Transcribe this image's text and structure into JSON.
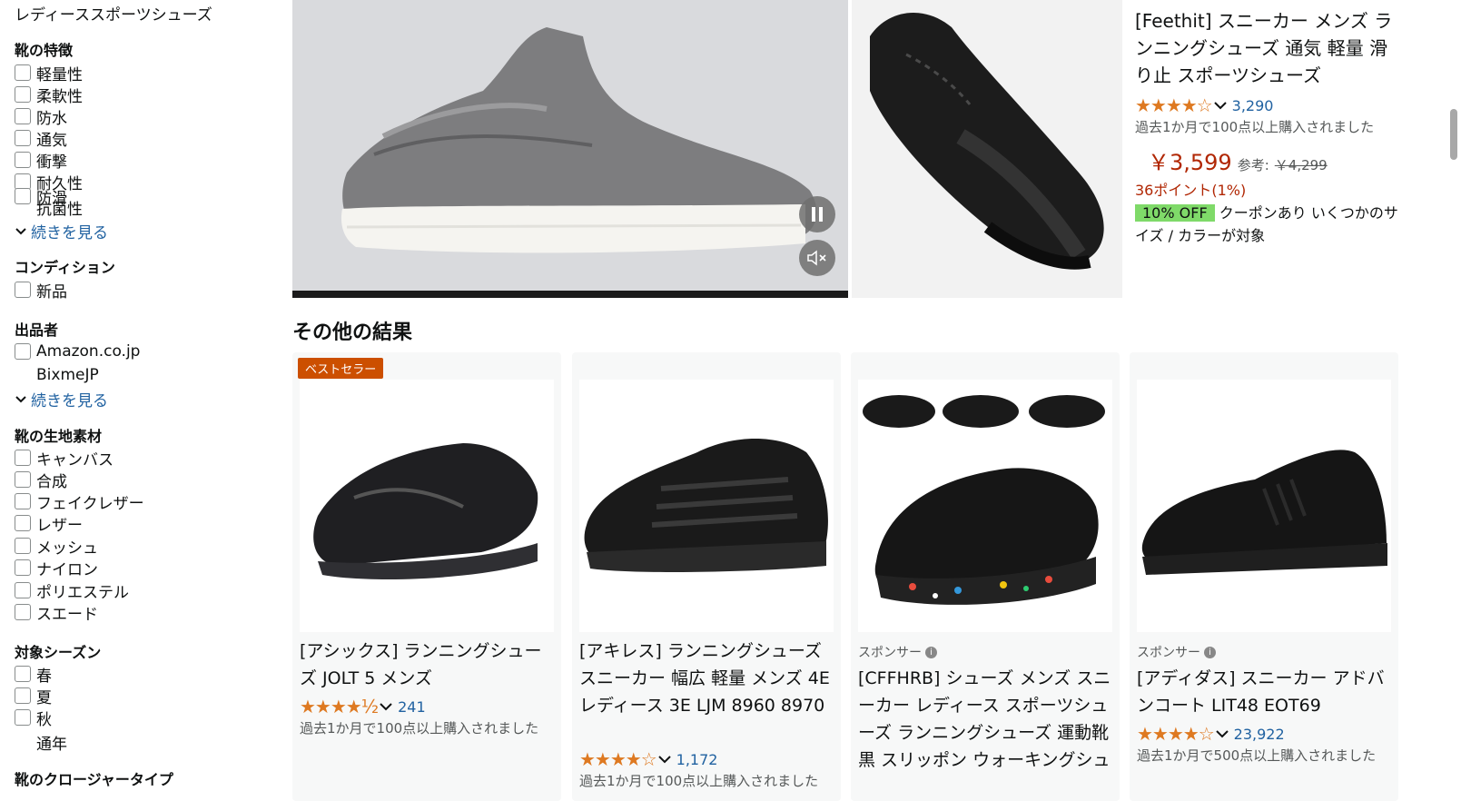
{
  "sidebar": {
    "top_link": "レディーススポーツシューズ",
    "features": {
      "heading": "靴の特徴",
      "options": [
        "軽量性",
        "柔軟性",
        "防水",
        "通気",
        "衝撃",
        "耐久性",
        "防滑",
        "抗菌性"
      ],
      "more": "続きを見る"
    },
    "condition": {
      "heading": "コンディション",
      "options": [
        "新品"
      ]
    },
    "seller": {
      "heading": "出品者",
      "options": [
        "Amazon.co.jp",
        "BixmeJP"
      ],
      "more": "続きを見る"
    },
    "material": {
      "heading": "靴の生地素材",
      "options": [
        "キャンバス",
        "合成",
        "フェイクレザー",
        "レザー",
        "メッシュ",
        "ナイロン",
        "ポリエステル",
        "スエード"
      ]
    },
    "season": {
      "heading": "対象シーズン",
      "options": [
        "春",
        "夏",
        "秋",
        "通年"
      ]
    },
    "closure": {
      "heading": "靴のクロージャータイプ"
    }
  },
  "hero": {
    "title": "[Feethit] スニーカー メンズ ランニングシューズ 通気 軽量 滑り止 スポーツシューズ",
    "rating_stars": "★★★★☆",
    "rating_count": "3,290",
    "bought": "過去1か月で100点以上購入されました",
    "price": "￥3,599",
    "ref_label": "参考:",
    "ref_price": "￥4,299",
    "points": "36ポイント(1%)",
    "coupon_badge": "10% OFF",
    "coupon_text": "クーポンあり いくつかのサイズ / カラーが対象"
  },
  "more_results": {
    "title": "その他の結果",
    "sponsor_label": "スポンサー",
    "cards": [
      {
        "badge": "ベストセラー",
        "title": "[アシックス] ランニングシューズ JOLT 5 メンズ",
        "stars": "★★★★½",
        "count": "241",
        "bought": "過去1か月で100点以上購入されました"
      },
      {
        "title": "[アキレス] ランニングシューズ スニーカー 幅広 軽量 メンズ 4E レディース 3E LJM 8960 8970",
        "stars": "★★★★☆",
        "count": "1,172",
        "bought": "過去1か月で100点以上購入されました"
      },
      {
        "title": "[CFFHRB] シューズ メンズ スニーカー レディース スポーツシューズ ランニングシューズ 運動靴 黒 スリッポン ウォーキングシューズ"
      },
      {
        "title": "[アディダス] スニーカー アドバンコート LIT48 EOT69",
        "stars": "★★★★☆",
        "count": "23,922",
        "bought": "過去1か月で500点以上購入されました"
      }
    ]
  },
  "colors": {
    "price": "#b12704",
    "link": "#2162a1",
    "star": "#de7921",
    "coupon": "#7fda69",
    "bestseller": "#cc4f00"
  }
}
